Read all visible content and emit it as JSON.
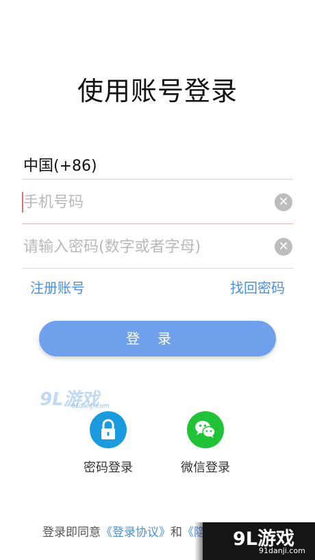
{
  "page": {
    "title": "使用账号登录",
    "country_code": "中国(+86)"
  },
  "form": {
    "phone_placeholder": "手机号码",
    "password_placeholder": "请输入密码(数字或者字母)",
    "register_link": "注册账号",
    "forgot_link": "找回密码",
    "login_button": "登录"
  },
  "social": {
    "password_login_label": "密码登录",
    "wechat_login_label": "微信登录"
  },
  "footer": {
    "prefix": "登录即同意",
    "agreement": "《登录协议》",
    "and": "和",
    "privacy_partial": "《隐"
  },
  "watermark": {
    "top_logo": "9L游戏",
    "top_url": "91danji.com",
    "corner_logo": "9L游戏",
    "corner_url": "91danji.com"
  },
  "colors": {
    "accent": "#6fa0ec",
    "link": "#4a8fe0",
    "password_icon_bg": "#1a9be0",
    "wechat_icon_bg": "#20c335"
  }
}
